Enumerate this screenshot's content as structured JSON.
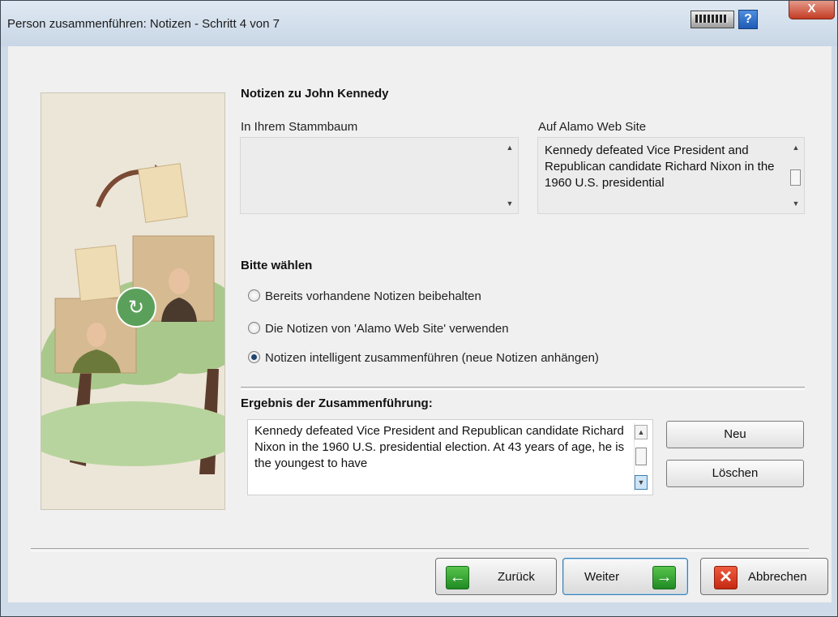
{
  "window": {
    "title": "Person zusammenführen: Notizen - Schritt 4 von 7",
    "help_label": "?",
    "close_label": "X"
  },
  "notes_heading": "Notizen zu John Kennedy",
  "left_panel": {
    "label": "In Ihrem Stammbaum",
    "text": ""
  },
  "right_panel": {
    "label": "Auf Alamo Web Site",
    "text": "Kennedy defeated Vice President and Republican candidate Richard Nixon in the 1960 U.S. presidential"
  },
  "choose_heading": "Bitte wählen",
  "options": [
    {
      "label": "Bereits vorhandene Notizen beibehalten",
      "checked": false
    },
    {
      "label": "Die Notizen von 'Alamo Web Site' verwenden",
      "checked": false
    },
    {
      "label": "Notizen intelligent zusammenführen (neue Notizen anhängen)",
      "checked": true
    }
  ],
  "result": {
    "label": "Ergebnis der Zusammenführung:",
    "text": "Kennedy defeated Vice President and Republican candidate Richard Nixon in the 1960 U.S. presidential election. At 43 years of age, he is the youngest to have"
  },
  "side_buttons": {
    "new": "Neu",
    "delete": "Löschen"
  },
  "footer": {
    "back": "Zurück",
    "next": "Weiter",
    "cancel": "Abbrechen"
  },
  "icons": {
    "back": "arrow-left-icon",
    "next": "arrow-right-icon",
    "cancel": "x-icon",
    "keyboard": "keyboard-icon",
    "help": "help-icon"
  },
  "colors": {
    "titlebar": "#d3e0ed",
    "green_icon": "#2a9b2e",
    "red_icon": "#d8381e",
    "radio_dot": "#21436f"
  }
}
